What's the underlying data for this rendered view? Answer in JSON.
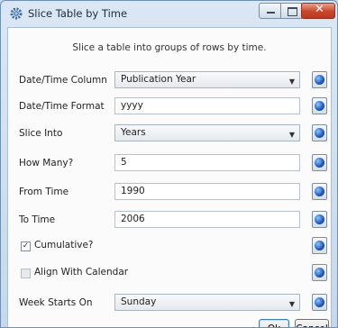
{
  "window": {
    "title": "Slice Table by Time"
  },
  "description": "Slice a table into groups of rows by time.",
  "fields": {
    "datetime_column": {
      "label": "Date/Time Column",
      "value": "Publication Year"
    },
    "datetime_format": {
      "label": "Date/Time Format",
      "value": "yyyy"
    },
    "slice_into": {
      "label": "Slice Into",
      "value": "Years"
    },
    "how_many": {
      "label": "How Many?",
      "value": "5"
    },
    "from_time": {
      "label": "From Time",
      "value": "1990"
    },
    "to_time": {
      "label": "To Time",
      "value": "2006"
    },
    "week_starts_on": {
      "label": "Week Starts On",
      "value": "Sunday"
    }
  },
  "checkboxes": {
    "cumulative": {
      "label": "Cumulative?",
      "checked": true
    },
    "align_with_calendar": {
      "label": "Align With Calendar",
      "checked": false
    }
  },
  "buttons": {
    "ok": "Ok",
    "cancel": "Cancel"
  },
  "icons": {
    "app": "gear-icon",
    "help": "help-icon"
  },
  "colors": {
    "close": "#c9452b",
    "accent": "#1d55b8"
  }
}
